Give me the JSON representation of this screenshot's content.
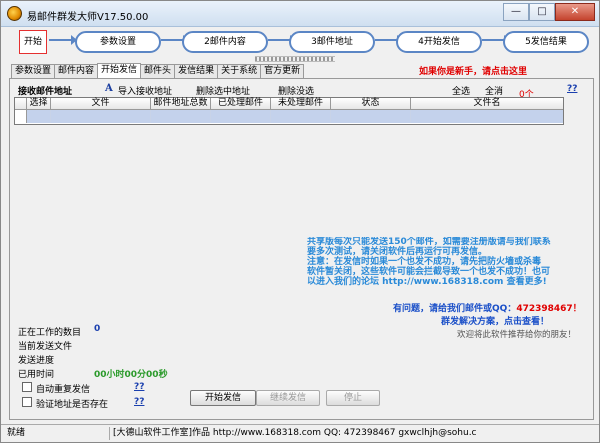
{
  "window": {
    "title": "易邮件群发大师V17.50.00",
    "minimize": "—",
    "maximize": "□",
    "close": "✕"
  },
  "flow": {
    "start": "开始",
    "steps": [
      "参数设置",
      "2邮件内容",
      "3邮件地址",
      "4开始发信",
      "5发信结果"
    ]
  },
  "tabs": [
    "参数设置",
    "邮件内容",
    "开始发信",
    "邮件头",
    "发信结果",
    "关于系统",
    "官方更新"
  ],
  "active_tab": "开始发信",
  "newbie_link": "如果你是新手，请点击这里",
  "toolbar": {
    "recv_label": "接收邮件地址",
    "import_icon": "A",
    "import_btn": "导入接收地址",
    "delete_selected": "删除选中地址",
    "delete_unselected": "删除没选",
    "select_all": "全选",
    "invert_select": "全消",
    "count": "0个",
    "help": "??"
  },
  "grid": {
    "columns": [
      "选择",
      "文件",
      "邮件地址总数",
      "已处理邮件",
      "未处理邮件",
      "状态",
      "文件名"
    ]
  },
  "status": {
    "working_label": "正在工作的数目",
    "working_value": "0",
    "current_file_label": "当前发送文件",
    "progress_label": "发送进度",
    "elapsed_label": "已用时间",
    "elapsed_value": "00小时00分00秒",
    "auto_repeat_label": "自动重复发信",
    "verify_label": "验证地址是否存在",
    "help1": "??",
    "help2": "??"
  },
  "buttons": {
    "start_send": "开始发信",
    "continue_send": "继续发信",
    "stop": "停止"
  },
  "notice": {
    "line1": "共享版每次只能发送150个邮件，如需要注册版请与我们联系",
    "line2": "要多次测试，请关闭软件后再运行可再发信。",
    "line3": "注意：在发信时如果一个也发不成功，请先把防火墙或杀毒",
    "line4": "软件暂关闭，这些软件可能会拦截导致一个也发不成功！也可",
    "line5": "以进入我们的论坛 http://www.168318.com 查看更多!"
  },
  "contact": {
    "text": "有问题，请给我们邮件或QQ：",
    "qq": "472398467！"
  },
  "solution_link": "群发解决方案，点击查看！",
  "recommend": "欢迎将此软件推荐给你的朋友！",
  "statusbar": {
    "state": "就绪",
    "company": "[大德山软件工作室]作品 http://www.168318.com QQ: 472398467 gxwclhjh@sohu.c"
  }
}
